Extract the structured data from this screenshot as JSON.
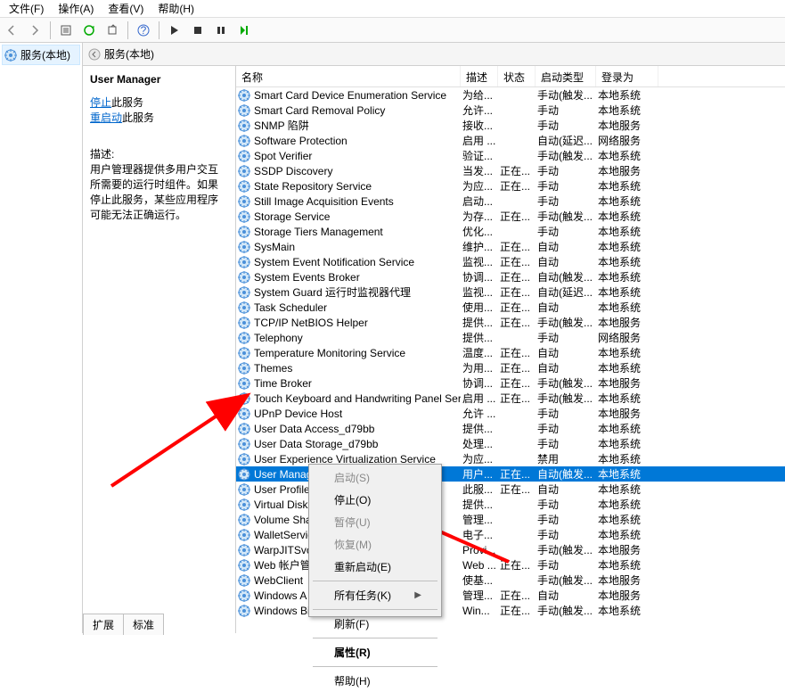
{
  "menu": {
    "file": "文件(F)",
    "action": "操作(A)",
    "view": "查看(V)",
    "help": "帮助(H)"
  },
  "tree": {
    "root": "服务(本地)"
  },
  "content_header": "服务(本地)",
  "detail": {
    "selected_service": "User Manager",
    "link_stop": "停止",
    "link_stop_suffix": "此服务",
    "link_restart": "重启动",
    "link_restart_suffix": "此服务",
    "desc_label": "描述:",
    "desc_text": "用户管理器提供多用户交互所需要的运行时组件。如果停止此服务，某些应用程序可能无法正确运行。"
  },
  "columns": {
    "name": "名称",
    "desc": "描述",
    "status": "状态",
    "start": "启动类型",
    "logon": "登录为"
  },
  "services": [
    {
      "name": "Smart Card Device Enumeration Service",
      "desc": "为给...",
      "status": "",
      "start": "手动(触发...",
      "logon": "本地系统"
    },
    {
      "name": "Smart Card Removal Policy",
      "desc": "允许...",
      "status": "",
      "start": "手动",
      "logon": "本地系统"
    },
    {
      "name": "SNMP 陷阱",
      "desc": "接收...",
      "status": "",
      "start": "手动",
      "logon": "本地服务"
    },
    {
      "name": "Software Protection",
      "desc": "启用 ...",
      "status": "",
      "start": "自动(延迟...",
      "logon": "网络服务"
    },
    {
      "name": "Spot Verifier",
      "desc": "验证...",
      "status": "",
      "start": "手动(触发...",
      "logon": "本地系统"
    },
    {
      "name": "SSDP Discovery",
      "desc": "当发...",
      "status": "正在...",
      "start": "手动",
      "logon": "本地服务"
    },
    {
      "name": "State Repository Service",
      "desc": "为应...",
      "status": "正在...",
      "start": "手动",
      "logon": "本地系统"
    },
    {
      "name": "Still Image Acquisition Events",
      "desc": "启动...",
      "status": "",
      "start": "手动",
      "logon": "本地系统"
    },
    {
      "name": "Storage Service",
      "desc": "为存...",
      "status": "正在...",
      "start": "手动(触发...",
      "logon": "本地系统"
    },
    {
      "name": "Storage Tiers Management",
      "desc": "优化...",
      "status": "",
      "start": "手动",
      "logon": "本地系统"
    },
    {
      "name": "SysMain",
      "desc": "维护...",
      "status": "正在...",
      "start": "自动",
      "logon": "本地系统"
    },
    {
      "name": "System Event Notification Service",
      "desc": "监视...",
      "status": "正在...",
      "start": "自动",
      "logon": "本地系统"
    },
    {
      "name": "System Events Broker",
      "desc": "协调...",
      "status": "正在...",
      "start": "自动(触发...",
      "logon": "本地系统"
    },
    {
      "name": "System Guard 运行时监视器代理",
      "desc": "监视...",
      "status": "正在...",
      "start": "自动(延迟...",
      "logon": "本地系统"
    },
    {
      "name": "Task Scheduler",
      "desc": "使用...",
      "status": "正在...",
      "start": "自动",
      "logon": "本地系统"
    },
    {
      "name": "TCP/IP NetBIOS Helper",
      "desc": "提供...",
      "status": "正在...",
      "start": "手动(触发...",
      "logon": "本地服务"
    },
    {
      "name": "Telephony",
      "desc": "提供...",
      "status": "",
      "start": "手动",
      "logon": "网络服务"
    },
    {
      "name": "Temperature Monitoring Service",
      "desc": "温度...",
      "status": "正在...",
      "start": "自动",
      "logon": "本地系统"
    },
    {
      "name": "Themes",
      "desc": "为用...",
      "status": "正在...",
      "start": "自动",
      "logon": "本地系统"
    },
    {
      "name": "Time Broker",
      "desc": "协调...",
      "status": "正在...",
      "start": "手动(触发...",
      "logon": "本地服务"
    },
    {
      "name": "Touch Keyboard and Handwriting Panel Service",
      "desc": "启用 ...",
      "status": "正在...",
      "start": "手动(触发...",
      "logon": "本地系统"
    },
    {
      "name": "UPnP Device Host",
      "desc": "允许 ...",
      "status": "",
      "start": "手动",
      "logon": "本地服务"
    },
    {
      "name": "User Data Access_d79bb",
      "desc": "提供...",
      "status": "",
      "start": "手动",
      "logon": "本地系统"
    },
    {
      "name": "User Data Storage_d79bb",
      "desc": "处理...",
      "status": "",
      "start": "手动",
      "logon": "本地系统"
    },
    {
      "name": "User Experience Virtualization Service",
      "desc": "为应...",
      "status": "",
      "start": "禁用",
      "logon": "本地系统"
    },
    {
      "name": "User Manager",
      "desc": "用户...",
      "status": "正在...",
      "start": "自动(触发...",
      "logon": "本地系统",
      "selected": true
    },
    {
      "name": "User Profile",
      "desc": "此服...",
      "status": "正在...",
      "start": "自动",
      "logon": "本地系统"
    },
    {
      "name": "Virtual Disk",
      "desc": "提供...",
      "status": "",
      "start": "手动",
      "logon": "本地系统"
    },
    {
      "name": "Volume Sha",
      "desc": "管理...",
      "status": "",
      "start": "手动",
      "logon": "本地系统"
    },
    {
      "name": "WalletServic",
      "desc": "电子...",
      "status": "",
      "start": "手动",
      "logon": "本地系统"
    },
    {
      "name": "WarpJITSvc",
      "desc": "Provi...",
      "status": "",
      "start": "手动(触发...",
      "logon": "本地服务"
    },
    {
      "name": "Web 帐户管",
      "desc": "Web ...",
      "status": "正在...",
      "start": "手动",
      "logon": "本地系统"
    },
    {
      "name": "WebClient",
      "desc": "使基...",
      "status": "",
      "start": "手动(触发...",
      "logon": "本地服务"
    },
    {
      "name": "Windows A",
      "desc": "管理...",
      "status": "正在...",
      "start": "自动",
      "logon": "本地服务"
    },
    {
      "name": "Windows Bi",
      "desc": "Win...",
      "status": "正在...",
      "start": "手动(触发...",
      "logon": "本地系统"
    }
  ],
  "context": {
    "start": "启动(S)",
    "stop": "停止(O)",
    "pause": "暂停(U)",
    "resume": "恢复(M)",
    "restart": "重新启动(E)",
    "alltasks": "所有任务(K)",
    "refresh": "刷新(F)",
    "properties": "属性(R)",
    "help": "帮助(H)"
  },
  "tabs": {
    "extended": "扩展",
    "standard": "标准"
  }
}
